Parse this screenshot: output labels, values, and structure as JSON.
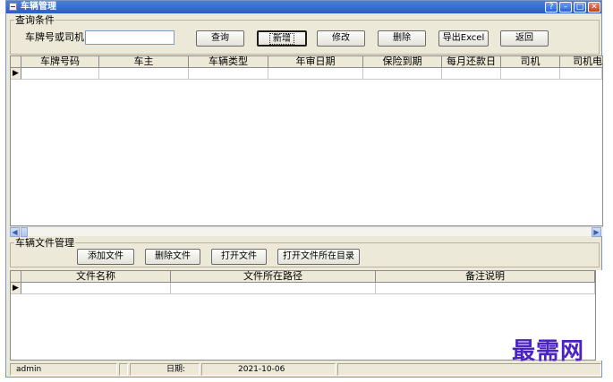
{
  "window": {
    "title": "车辆管理",
    "controls": {
      "help": "?",
      "minimize": "–",
      "maximize": "□",
      "close": "✕"
    }
  },
  "search": {
    "group_title": "查询条件",
    "field_label": "车牌号或司机",
    "field_value": "",
    "buttons": {
      "query": "查询",
      "add": "新增",
      "edit": "修改",
      "delete": "删除",
      "export": "导出Excel",
      "back": "返回"
    }
  },
  "vehicle_table": {
    "columns": [
      "车牌号码",
      "车主",
      "车辆类型",
      "年审日期",
      "保险到期",
      "每月还款日",
      "司机",
      "司机电"
    ],
    "rows": [
      [
        "",
        "",
        "",
        "",
        "",
        "",
        "",
        ""
      ]
    ],
    "current_row_marker": "▶"
  },
  "scrollbar": {
    "left_arrow": "◀",
    "right_arrow": "▶"
  },
  "files": {
    "group_title": "车辆文件管理",
    "buttons": {
      "add_file": "添加文件",
      "delete_file": "删除文件",
      "open_file": "打开文件",
      "open_dir": "打开文件所在目录"
    },
    "columns": [
      "文件名称",
      "文件所在路径",
      "备注说明"
    ],
    "rows": [
      [
        "",
        "",
        ""
      ]
    ],
    "current_row_marker": "▶"
  },
  "status": {
    "user": "admin",
    "date_label": "日期:",
    "date_value": "2021-10-06"
  },
  "watermark": "最需网"
}
